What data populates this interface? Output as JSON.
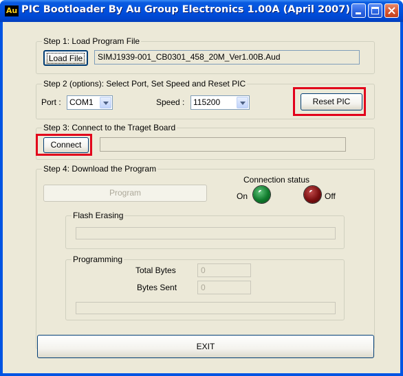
{
  "window": {
    "app_icon_text": "Au",
    "title": "PIC Bootloader By Au Group Electronics 1.00A (April 2007)",
    "minimize_label": "minimize",
    "maximize_label": "maximize",
    "close_label": "close"
  },
  "step1": {
    "legend": "Step 1: Load Program File",
    "load_button": "Load File",
    "file_path": "SIMJ1939-001_CB0301_458_20M_Ver1.00B.Aud"
  },
  "step2": {
    "legend": "Step 2 (options): Select Port, Set Speed and Reset PIC",
    "port_label": "Port :",
    "port_value": "COM1",
    "speed_label": "Speed :",
    "speed_value": "115200",
    "reset_button": "Reset PIC"
  },
  "step3": {
    "legend": "Step 3: Connect to the Traget Board",
    "connect_button": "Connect",
    "status_field": ""
  },
  "step4": {
    "legend": "Step 4: Download the Program",
    "program_button": "Program",
    "connection_status": {
      "legend": "Connection status",
      "on_label": "On",
      "off_label": "Off",
      "on_color": "#0f7a2c",
      "off_color": "#7a0f10"
    },
    "flash_erasing": {
      "legend": "Flash Erasing"
    },
    "programming": {
      "legend": "Programming",
      "total_bytes_label": "Total Bytes",
      "total_bytes_value": "0",
      "bytes_sent_label": "Bytes Sent",
      "bytes_sent_value": "0"
    }
  },
  "exit_button": "EXIT",
  "colors": {
    "highlight_box": "#e2001a",
    "dialog_bg": "#ece9d8",
    "titlebar": "#0050df"
  }
}
